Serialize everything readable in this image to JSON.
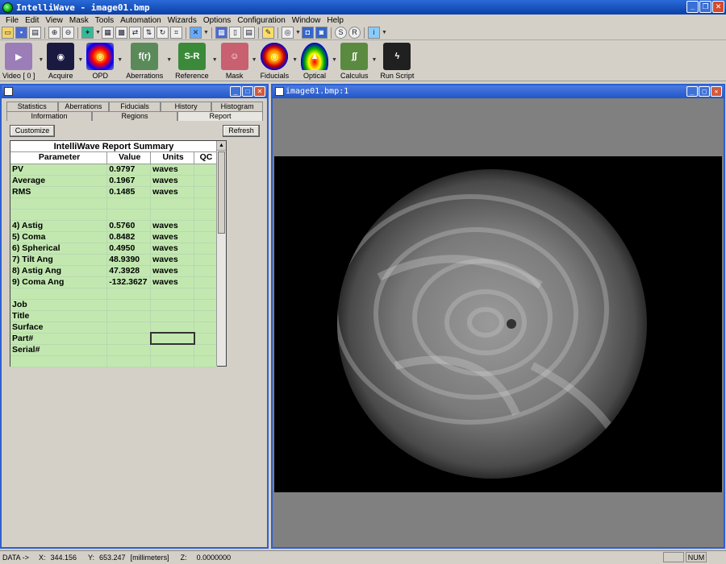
{
  "app": {
    "title": "IntelliWave - image01.bmp"
  },
  "menu": [
    "File",
    "Edit",
    "View",
    "Mask",
    "Tools",
    "Automation",
    "Wizards",
    "Options",
    "Configuration",
    "Window",
    "Help"
  ],
  "toolbar_big": [
    {
      "label": "Video [ 0 ]",
      "icon": "video-camera-icon",
      "color": "#9b7db8",
      "glyph": "▶"
    },
    {
      "label": "Acquire",
      "icon": "camera-icon",
      "color": "#1a1a40",
      "glyph": "◉"
    },
    {
      "label": "OPD",
      "icon": "opd-icon",
      "color": "#7a8a7a",
      "glyph": "◎"
    },
    {
      "label": "Aberrations",
      "icon": "aberrations-icon",
      "color": "#5a8a5a",
      "glyph": "f(r)"
    },
    {
      "label": "Reference",
      "icon": "reference-icon",
      "color": "#3a8a3a",
      "glyph": "S-R"
    },
    {
      "label": "Mask",
      "icon": "mask-icon",
      "color": "#c86070",
      "glyph": "☺"
    },
    {
      "label": "Fiducials",
      "icon": "fiducials-icon",
      "color": "#d0a020",
      "glyph": "◎"
    },
    {
      "label": "Optical",
      "icon": "optical-icon",
      "color": "#2040b0",
      "glyph": "▲"
    },
    {
      "label": "Calculus",
      "icon": "calculus-icon",
      "color": "#5a8a40",
      "glyph": "∫∫"
    },
    {
      "label": "Run Script",
      "icon": "lightning-icon",
      "color": "#202020",
      "glyph": "ϟ"
    }
  ],
  "left_panel": {
    "tabs_top": [
      "Statistics",
      "Aberrations",
      "Fiducials",
      "History",
      "Histogram"
    ],
    "tabs_bottom": [
      "Information",
      "Regions",
      "Report"
    ],
    "customize_label": "Customize",
    "refresh_label": "Refresh",
    "report_title": "IntelliWave Report Summary",
    "columns": [
      "Parameter",
      "Value",
      "Units",
      "QC"
    ],
    "rows": [
      [
        "PV",
        "0.9797",
        "waves",
        ""
      ],
      [
        "Average",
        "0.1967",
        "waves",
        ""
      ],
      [
        "RMS",
        "0.1485",
        "waves",
        ""
      ],
      [
        "",
        "",
        "",
        ""
      ],
      [
        "",
        "",
        "",
        ""
      ],
      [
        " 4) Astig",
        "0.5760",
        "waves",
        ""
      ],
      [
        " 5) Coma",
        "0.8482",
        "waves",
        ""
      ],
      [
        " 6) Spherical",
        "0.4950",
        "waves",
        ""
      ],
      [
        " 7) Tilt Ang",
        "48.9390",
        "waves",
        ""
      ],
      [
        " 8) Astig Ang",
        "47.3928",
        "waves",
        ""
      ],
      [
        " 9) Coma Ang",
        "-132.3627",
        "waves",
        ""
      ],
      [
        "",
        "",
        "",
        ""
      ],
      [
        "Job",
        "",
        "",
        ""
      ],
      [
        "Title",
        "",
        "",
        ""
      ],
      [
        "Surface",
        "",
        "",
        ""
      ],
      [
        "Part#",
        "",
        "",
        ""
      ],
      [
        "Serial#",
        "",
        "",
        ""
      ],
      [
        "",
        "",
        "",
        ""
      ]
    ]
  },
  "image_window": {
    "title": "image01.bmp:1"
  },
  "statusbar": {
    "mode": "DATA ->",
    "x_label": "X:",
    "x_value": "344.156",
    "y_label": "Y:",
    "y_value": "653.247",
    "units": "[millimeters]",
    "z_label": "Z:",
    "z_value": "0.0000000",
    "num": "NUM"
  }
}
